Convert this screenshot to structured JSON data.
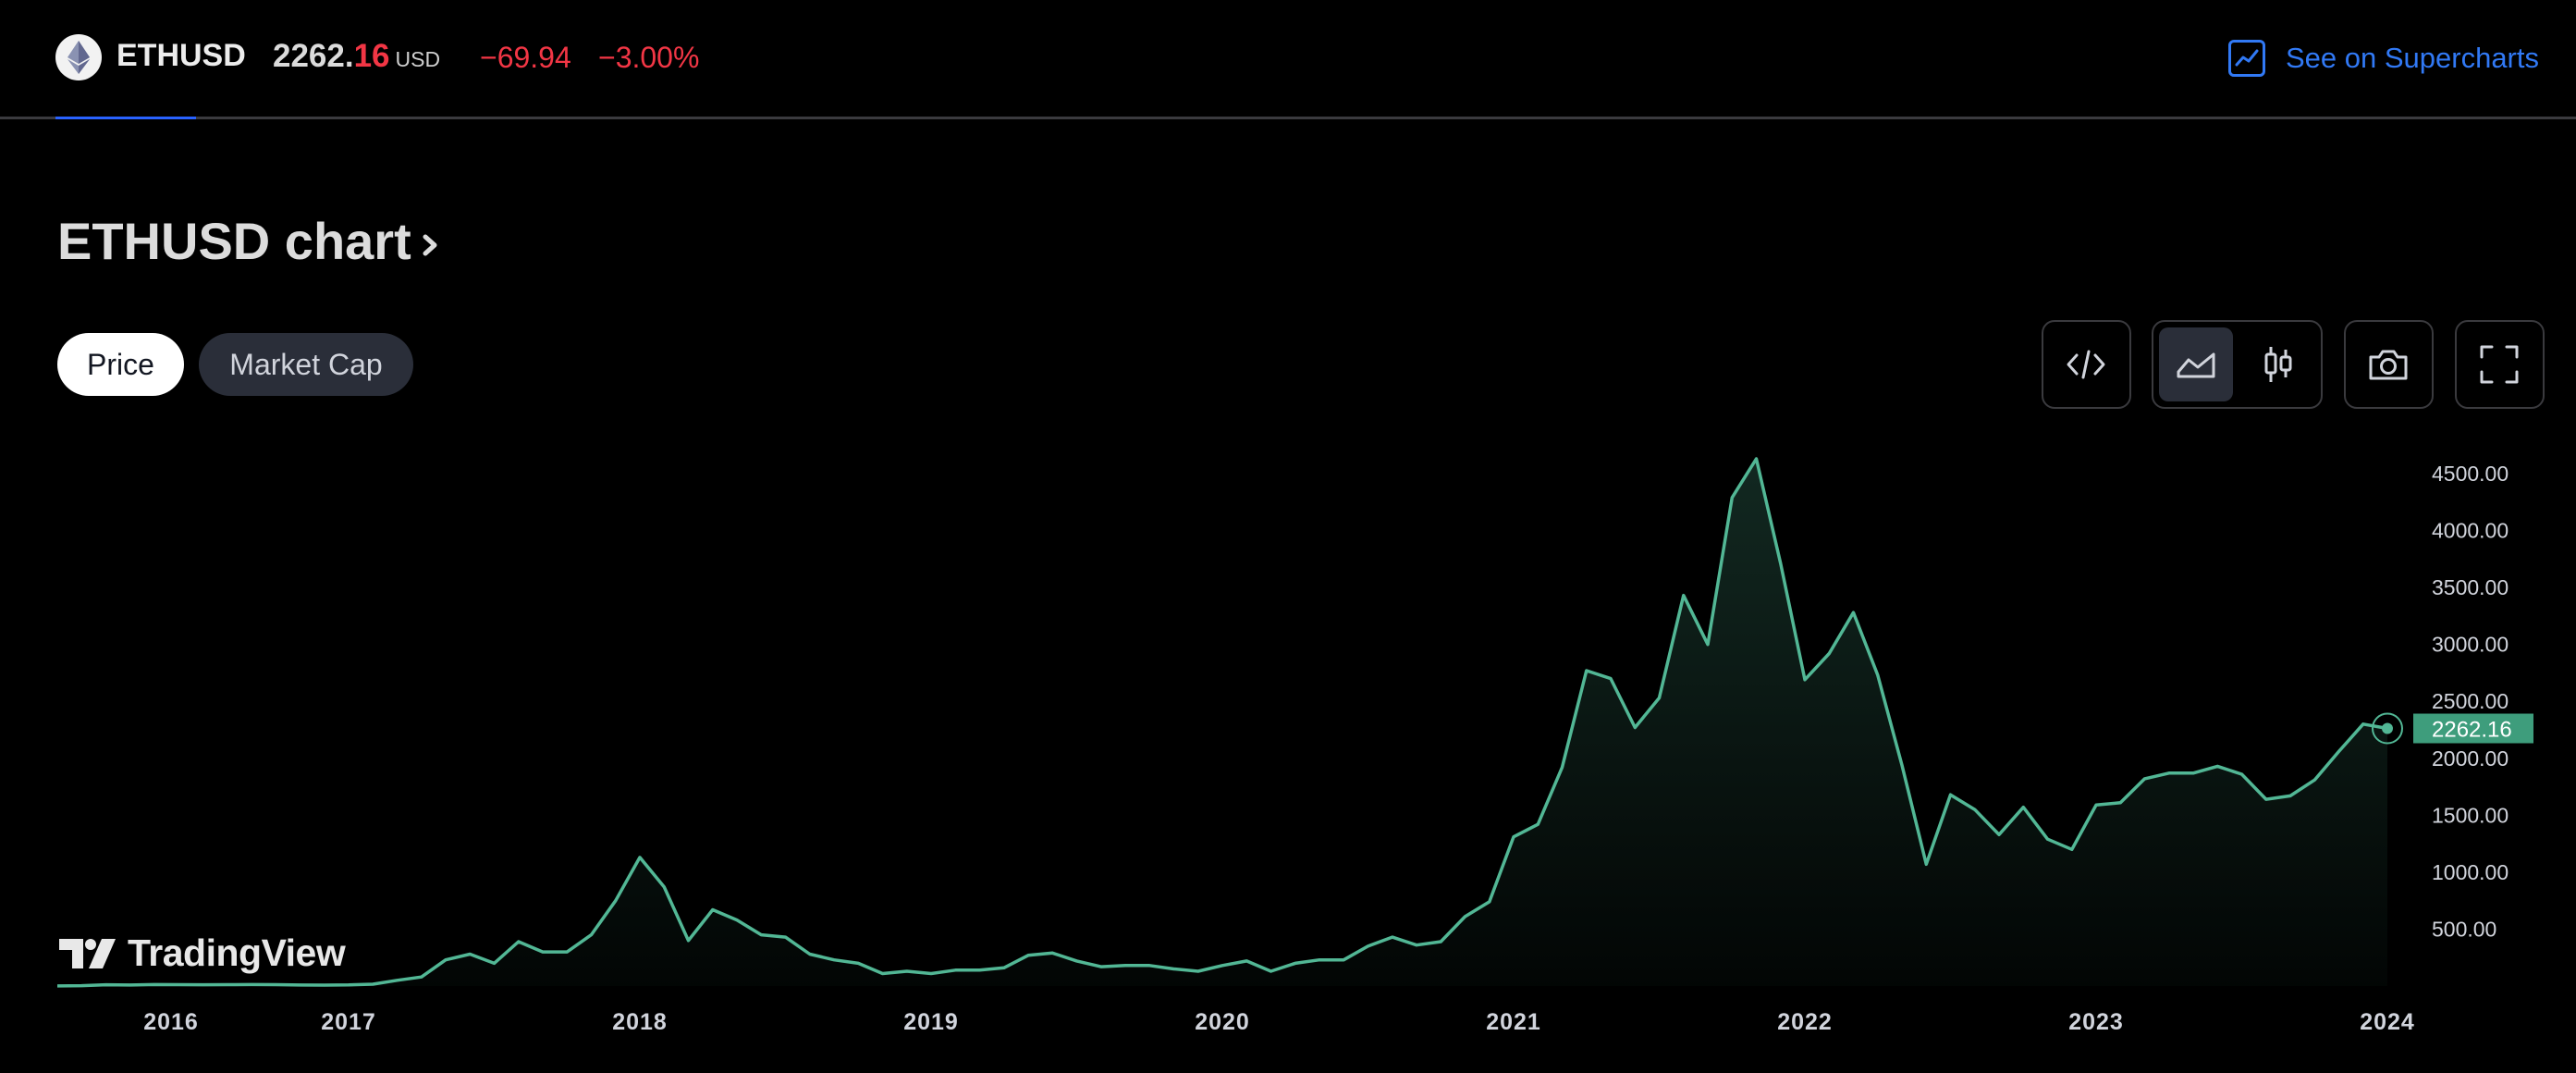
{
  "header": {
    "coin_icon": "ethereum-icon",
    "symbol": "ETHUSD",
    "price_int": "2262.",
    "price_dec": "16",
    "currency": "USD",
    "change": "−69.94",
    "change_pct": "−3.00%",
    "supercharts_label": "See on Supercharts",
    "supercharts_icon": "chart-line-icon"
  },
  "main": {
    "title": "ETHUSD chart",
    "tabs": [
      {
        "label": "Price",
        "active": true
      },
      {
        "label": "Market Cap",
        "active": false
      }
    ],
    "toolbar": {
      "embed_icon": "code-icon",
      "area_icon": "area-chart-icon",
      "candle_icon": "candlestick-icon",
      "snapshot_icon": "camera-icon",
      "fullscreen_icon": "fullscreen-icon",
      "active_style": "area"
    }
  },
  "watermark": "TradingView",
  "colors": {
    "line": "#52b795",
    "negative": "#f23645",
    "accent": "#3179f5",
    "last_price_bg": "#3e9d7c"
  },
  "chart_data": {
    "type": "area",
    "symbol": "ETHUSD",
    "frequency": "monthly",
    "ylim": [
      0,
      4500
    ],
    "yticks": [
      500,
      1000,
      1500,
      2000,
      2500,
      3000,
      3500,
      4000,
      4500
    ],
    "y_tick_labels": [
      "500.00",
      "1000.00",
      "1500.00",
      "2000.00",
      "2500.00",
      "3000.00",
      "3500.00",
      "4000.00",
      "4500.00"
    ],
    "x_tick_labels": [
      "2016",
      "2017",
      "2018",
      "2019",
      "2020",
      "2021",
      "2022",
      "2023",
      "2024"
    ],
    "last_price": 2262.16,
    "last_price_label": "2262.16",
    "grid": false,
    "series": [
      {
        "x": [
          "2016-01",
          "2016-02",
          "2016-03",
          "2016-04",
          "2016-05",
          "2016-06",
          "2016-07",
          "2016-08",
          "2016-09",
          "2016-10",
          "2016-11",
          "2016-12",
          "2017-01",
          "2017-02",
          "2017-03",
          "2017-04",
          "2017-05",
          "2017-06",
          "2017-07",
          "2017-08",
          "2017-09",
          "2017-10",
          "2017-11",
          "2017-12",
          "2018-01",
          "2018-02",
          "2018-03",
          "2018-04",
          "2018-05",
          "2018-06",
          "2018-07",
          "2018-08",
          "2018-09",
          "2018-10",
          "2018-11",
          "2018-12",
          "2019-01",
          "2019-02",
          "2019-03",
          "2019-04",
          "2019-05",
          "2019-06",
          "2019-07",
          "2019-08",
          "2019-09",
          "2019-10",
          "2019-11",
          "2019-12",
          "2020-01",
          "2020-02",
          "2020-03",
          "2020-04",
          "2020-05",
          "2020-06",
          "2020-07",
          "2020-08",
          "2020-09",
          "2020-10",
          "2020-11",
          "2020-12",
          "2021-01",
          "2021-02",
          "2021-03",
          "2021-04",
          "2021-05",
          "2021-06",
          "2021-07",
          "2021-08",
          "2021-09",
          "2021-10",
          "2021-11",
          "2021-12",
          "2022-01",
          "2022-02",
          "2022-03",
          "2022-04",
          "2022-05",
          "2022-06",
          "2022-07",
          "2022-08",
          "2022-09",
          "2022-10",
          "2022-11",
          "2022-12",
          "2023-01",
          "2023-02",
          "2023-03",
          "2023-04",
          "2023-05",
          "2023-06",
          "2023-07",
          "2023-08",
          "2023-09",
          "2023-10",
          "2023-11",
          "2023-12",
          "2024-01"
        ],
        "values": [
          1,
          3,
          11,
          9,
          13,
          12,
          11,
          12,
          13,
          12,
          9,
          8,
          10,
          16,
          50,
          80,
          230,
          280,
          200,
          390,
          300,
          300,
          450,
          750,
          1130,
          870,
          400,
          670,
          580,
          450,
          430,
          280,
          230,
          200,
          110,
          130,
          110,
          140,
          140,
          160,
          270,
          290,
          220,
          170,
          180,
          180,
          150,
          130,
          180,
          220,
          130,
          200,
          230,
          230,
          350,
          430,
          360,
          390,
          610,
          740,
          1310,
          1420,
          1920,
          2770,
          2700,
          2270,
          2530,
          3430,
          3000,
          4290,
          4630,
          3710,
          2690,
          2920,
          3280,
          2730,
          1940,
          1070,
          1680,
          1550,
          1330,
          1570,
          1290,
          1200,
          1590,
          1610,
          1820,
          1870,
          1870,
          1930,
          1860,
          1640,
          1670,
          1810,
          2060,
          2300,
          2262.16
        ]
      }
    ]
  }
}
